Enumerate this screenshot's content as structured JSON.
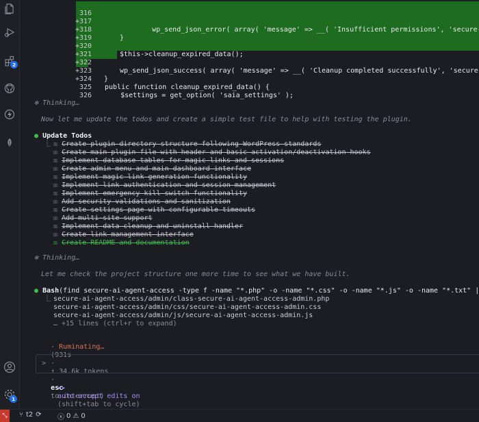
{
  "sidebar": {
    "icons": [
      "files-icon",
      "run-debug-icon",
      "extensions-icon",
      "github-icon",
      "lightning-icon",
      "leaf-icon",
      "account-icon",
      "settings-icon"
    ],
    "extensions_badge": "2",
    "settings_badge": "1"
  },
  "code": {
    "lines": [
      {
        "num": "316",
        "plus": "+",
        "text": "    wp_send_json_error( array( 'message' => __( 'Insufficient permissions', 'secure-ai-agent-a",
        "added": true
      },
      {
        "num": "317",
        "plus": "+",
        "text": "}",
        "added": true
      },
      {
        "num": "318",
        "plus": "+",
        "text": "",
        "added": true
      },
      {
        "num": "319",
        "plus": "+",
        "text": "$this->cleanup_expired_data();",
        "added": true
      },
      {
        "num": "320",
        "plus": "+",
        "text": "",
        "added": true
      },
      {
        "num": "321",
        "plus": "+",
        "text": "wp_send_json_success( array( 'message' => __( 'Cleanup completed successfully', 'secure-ai-age",
        "added": true
      },
      {
        "num": "322",
        "plus": "+",
        "text": "}",
        "added": true
      },
      {
        "num": "323",
        "plus": "+",
        "text": "",
        "added": true
      },
      {
        "num": "324",
        "plus": "",
        "text": "public function cleanup_expired_data() {",
        "added": false
      },
      {
        "num": "325",
        "plus": "",
        "text": "    $settings = get_option( 'saia_settings' );",
        "added": false
      },
      {
        "num": "326",
        "plus": "",
        "text": "",
        "added": false
      }
    ]
  },
  "thinking1": {
    "label": "Thinking…",
    "text": "Now let me update the todos and create a simple test file to help with testing the plugin."
  },
  "todos": {
    "title": "Update Todos",
    "items": [
      "Create plugin directory structure following WordPress standards",
      "Create main plugin file with header and basic activation/deactivation hooks",
      "Implement database tables for magic links and sessions",
      "Create admin menu and main dashboard interface",
      "Implement magic link generation functionality",
      "Implement link authentication and session management",
      "Implement emergency kill switch functionality",
      "Add security validations and sanitization",
      "Create settings page with configurable timeouts",
      "Add multi-site support",
      "Implement data cleanup and uninstall handler",
      "Create link management interface",
      "Create README and documentation"
    ]
  },
  "thinking2": {
    "label": "Thinking…",
    "text": "Let me check the project structure one more time to see what we have built."
  },
  "bash": {
    "name": "Bash",
    "command": "(find secure-ai-agent-access -type f -name \"*.php\" -o -name \"*.css\" -o -name \"*.js\" -o -name \"*.txt\" | sort)",
    "results": [
      "secure-ai-agent-access/admin/class-secure-ai-agent-access-admin.php",
      "secure-ai-agent-access/admin/css/secure-ai-agent-access-admin.css",
      "secure-ai-agent-access/admin/js/secure-ai-agent-access-admin.js"
    ],
    "more": "… +15 lines (ctrl+r to expand)"
  },
  "status_line": {
    "word": "Ruminating…",
    "time": "(931s",
    "tokens": "↑ 34.6k tokens",
    "esc": "esc",
    "interrupt": "to interrupt)"
  },
  "input": {
    "prompt": ">"
  },
  "mode": {
    "arrows": "▸▸",
    "label": "auto-accept edits on",
    "hint": "(shift+tab to cycle)"
  },
  "statusbar": {
    "branch": "t2",
    "errors": "0",
    "warnings": "0"
  }
}
